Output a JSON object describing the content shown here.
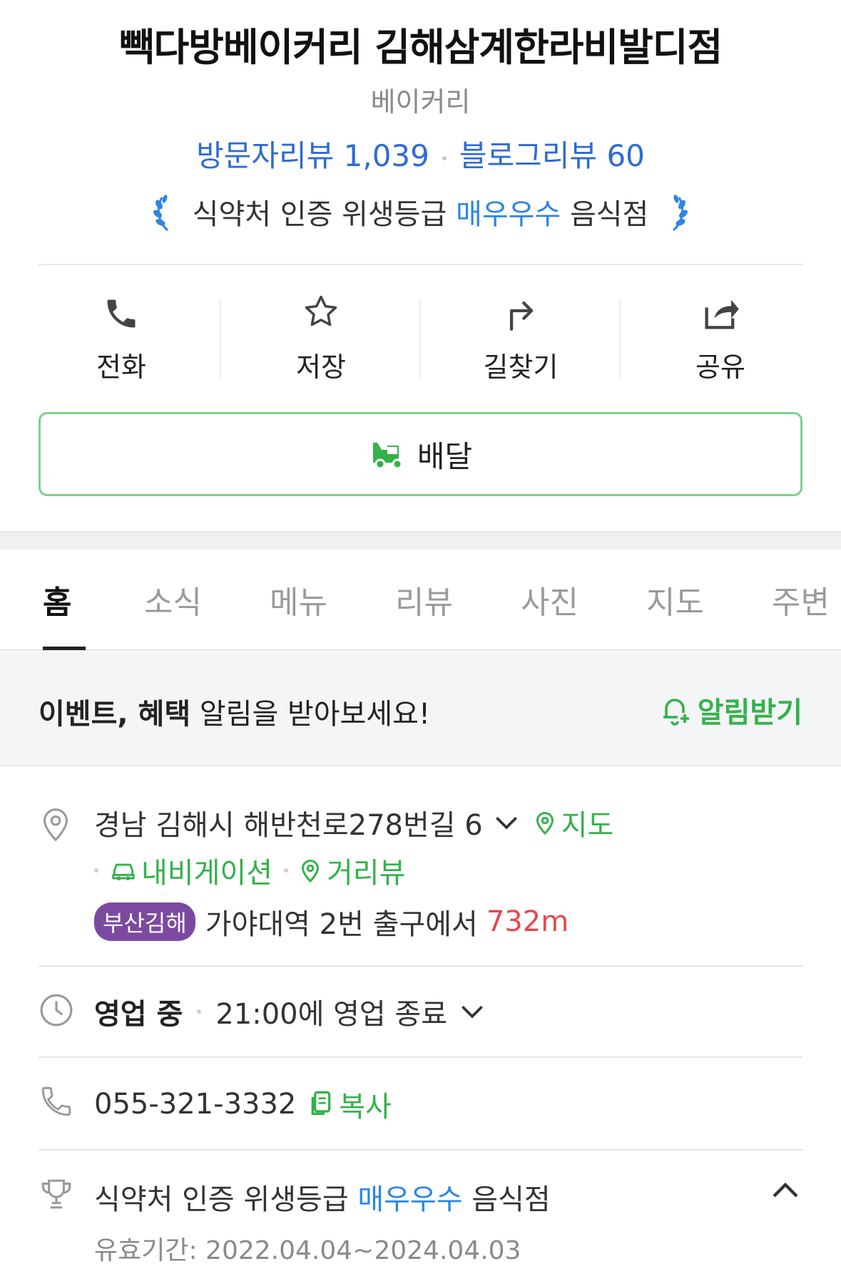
{
  "place": {
    "name": "빽다방베이커리 김해삼계한라비발디점",
    "category": "베이커리",
    "visitor_reviews_label": "방문자리뷰",
    "visitor_reviews_count": "1,039",
    "blog_reviews_label": "블로그리뷰",
    "blog_reviews_count": "60",
    "hygiene_prefix": "식약처 인증 위생등급",
    "hygiene_grade": "매우우수",
    "hygiene_suffix": "음식점"
  },
  "actions": [
    {
      "label": "전화",
      "icon": "phone-icon"
    },
    {
      "label": "저장",
      "icon": "star-icon"
    },
    {
      "label": "길찾기",
      "icon": "directions-icon"
    },
    {
      "label": "공유",
      "icon": "share-icon"
    }
  ],
  "delivery_label": "배달",
  "tabs": [
    "홈",
    "소식",
    "메뉴",
    "리뷰",
    "사진",
    "지도",
    "주변"
  ],
  "notice": {
    "bold_text": "이벤트, 혜택",
    "text": " 알림을 받아보세요!",
    "button_label": "알림받기"
  },
  "address": {
    "text": "경남 김해시 해반천로278번길 6",
    "map_label": "지도",
    "navigation_label": "내비게이션",
    "streetview_label": "거리뷰",
    "subway_line": "부산김해",
    "subway_text": "가야대역 2번 출구에서",
    "subway_distance": "732m"
  },
  "hours": {
    "status": "영업 중",
    "detail": "21:00에 영업 종료"
  },
  "phone": {
    "number": "055-321-3332",
    "copy_label": "복사"
  },
  "hygiene_info": {
    "prefix": "식약처 인증 위생등급",
    "grade": "매우우수",
    "suffix": "음식점",
    "validity": "유효기간: 2022.04.04~2024.04.03"
  },
  "colors": {
    "review_blue": "#2f6bd2",
    "grade_blue": "#2b86e6",
    "naver_green": "#33b24a",
    "subway_purple": "#7b4aa0",
    "distance_red": "#e5484d"
  }
}
